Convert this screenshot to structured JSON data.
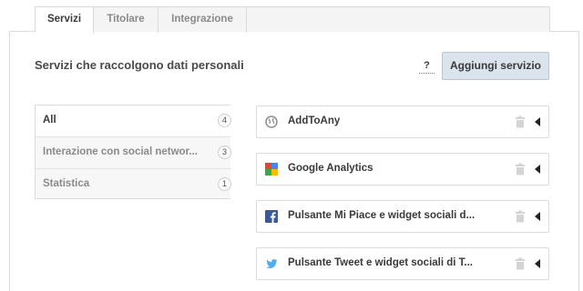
{
  "tabs": [
    {
      "label": "Servizi",
      "active": true
    },
    {
      "label": "Titolare",
      "active": false
    },
    {
      "label": "Integrazione",
      "active": false
    }
  ],
  "header": {
    "title": "Servizi che raccolgono dati personali",
    "help_label": "?",
    "add_button_label": "Aggiungi servizio"
  },
  "categories": [
    {
      "label": "All",
      "count": "4",
      "active": true
    },
    {
      "label": "Interazione con social networ...",
      "count": "3",
      "active": false
    },
    {
      "label": "Statistica",
      "count": "1",
      "active": false
    }
  ],
  "services": [
    {
      "name": "AddToAny",
      "icon": "globe-icon"
    },
    {
      "name": "Google Analytics",
      "icon": "google-analytics-icon"
    },
    {
      "name": "Pulsante Mi Piace e widget sociali d...",
      "icon": "facebook-icon"
    },
    {
      "name": "Pulsante Tweet e widget sociali di T...",
      "icon": "twitter-icon"
    }
  ],
  "colors": {
    "accent_button": "#dbe3ec",
    "facebook": "#3b5998",
    "twitter": "#55acee"
  }
}
